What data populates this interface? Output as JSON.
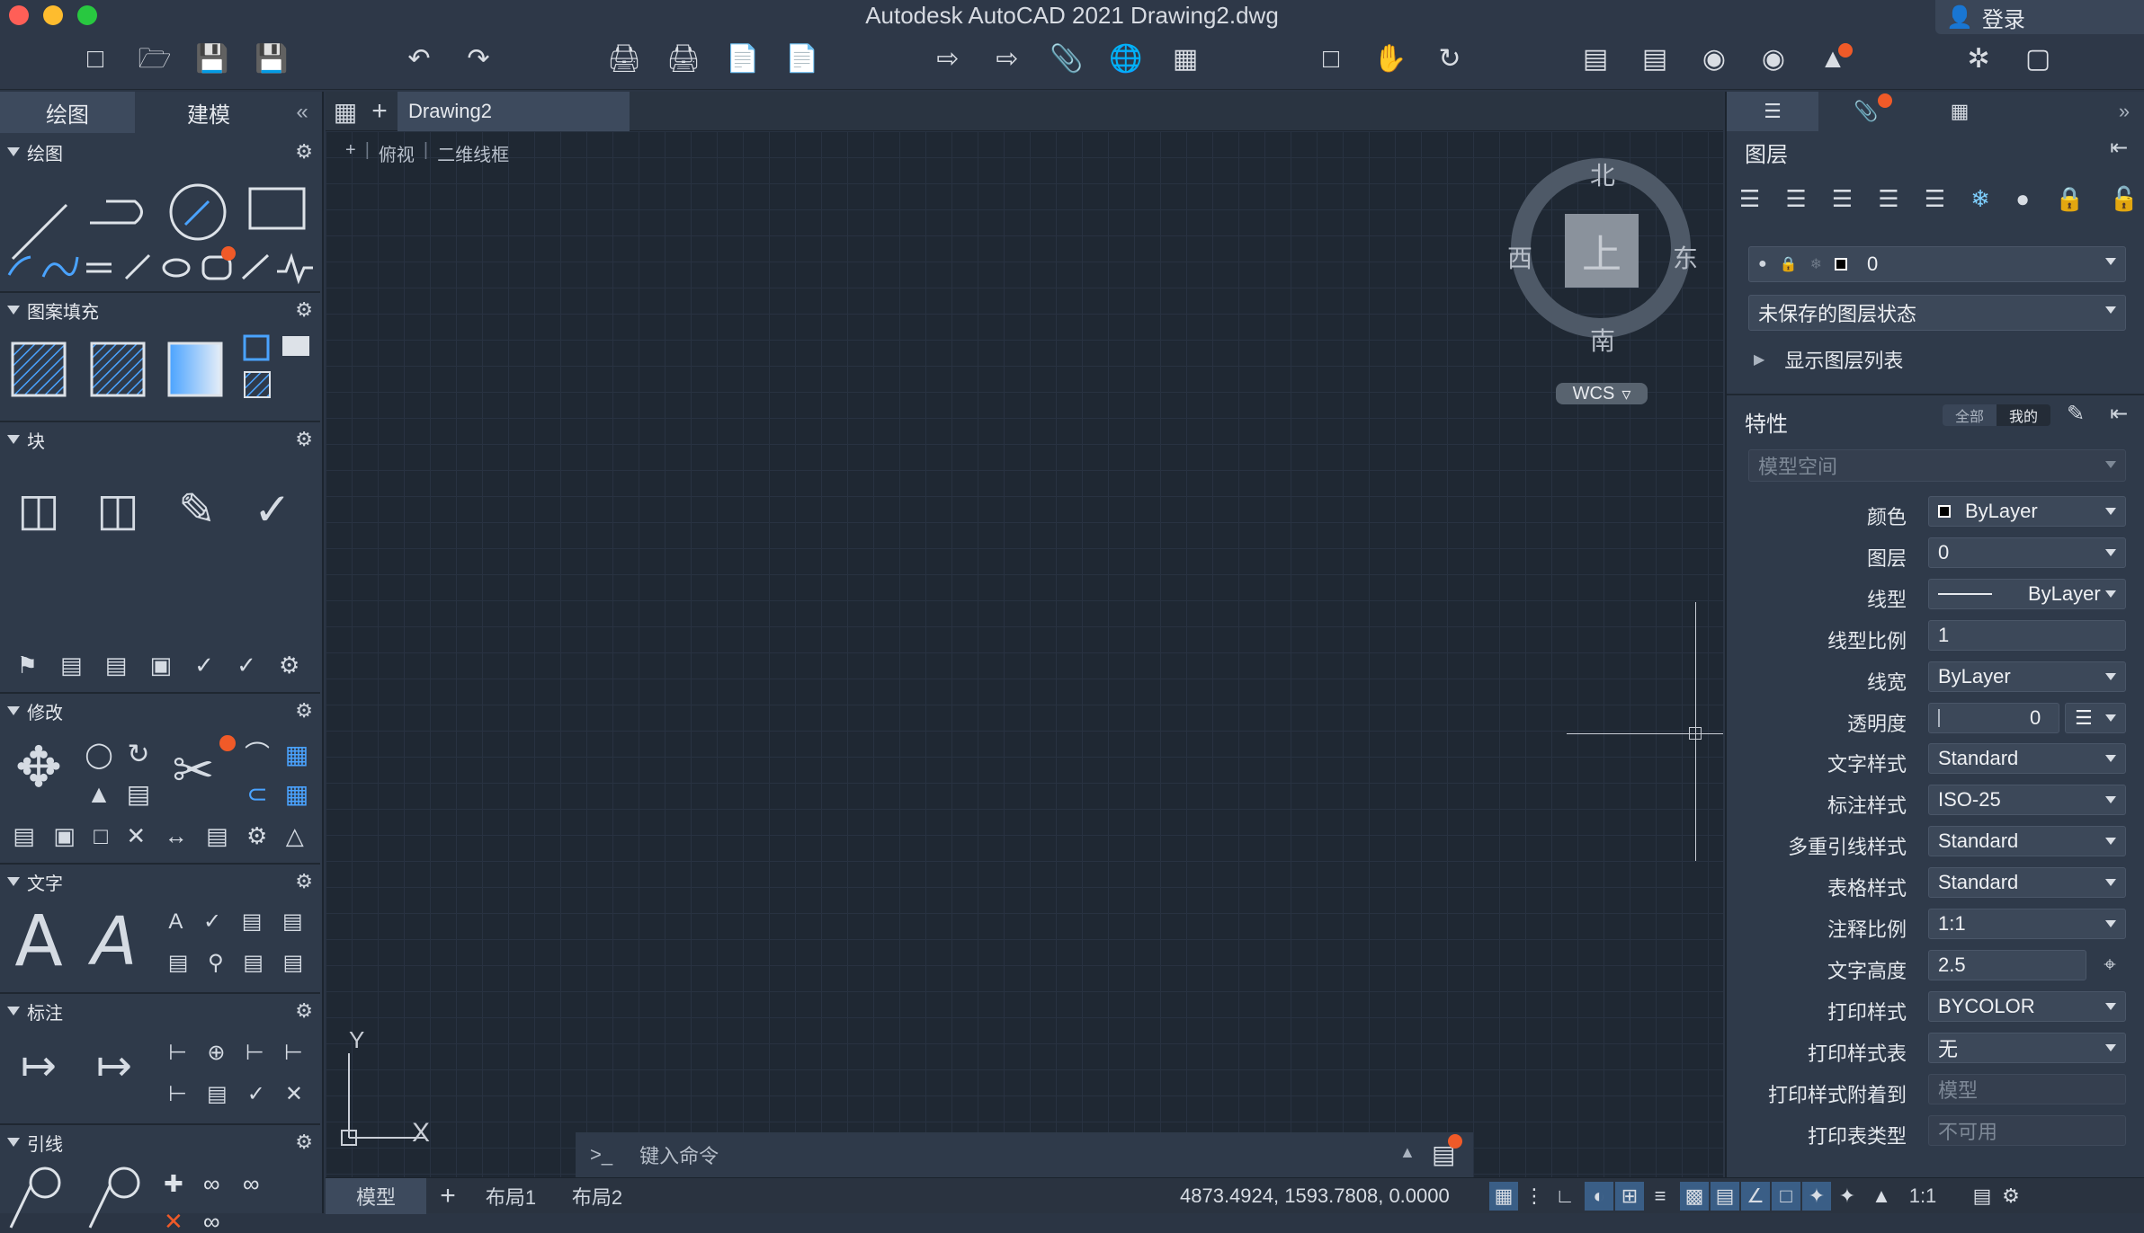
{
  "window": {
    "title": "Autodesk AutoCAD 2021    Drawing2.dwg",
    "login_label": "登录"
  },
  "left_panel": {
    "tabs": [
      "绘图",
      "建模"
    ],
    "sections": {
      "draw": "绘图",
      "hatch": "图案填充",
      "block": "块",
      "modify": "修改",
      "text": "文字",
      "dimension": "标注",
      "leader": "引线"
    }
  },
  "document": {
    "tab_name": "Drawing2",
    "view_label": "俯视",
    "visual_style": "二维线框"
  },
  "viewcube": {
    "north": "北",
    "south": "南",
    "east": "东",
    "west": "西",
    "face": "上",
    "wcs": "WCS"
  },
  "ucs": {
    "x": "X",
    "y": "Y"
  },
  "command": {
    "prompt": ">_",
    "placeholder": "键入命令"
  },
  "status": {
    "tabs": [
      "模型",
      "布局1",
      "布局2"
    ],
    "coords": "4873.4924, 1593.7808, 0.0000",
    "scale": "1:1"
  },
  "layers": {
    "title": "图层",
    "current_layer": "0",
    "layer_state": "未保存的图层状态",
    "show_list": "显示图层列表"
  },
  "properties": {
    "title": "特性",
    "filter_all": "全部",
    "filter_mine": "我的",
    "space": "模型空间",
    "rows": [
      {
        "label": "颜色",
        "value": "ByLayer"
      },
      {
        "label": "图层",
        "value": "0"
      },
      {
        "label": "线型",
        "value": "ByLayer"
      },
      {
        "label": "线型比例",
        "value": "1"
      },
      {
        "label": "线宽",
        "value": "ByLayer"
      },
      {
        "label": "透明度",
        "value": "0"
      },
      {
        "label": "文字样式",
        "value": "Standard"
      },
      {
        "label": "标注样式",
        "value": "ISO-25"
      },
      {
        "label": "多重引线样式",
        "value": "Standard"
      },
      {
        "label": "表格样式",
        "value": "Standard"
      },
      {
        "label": "注释比例",
        "value": "1:1"
      },
      {
        "label": "文字高度",
        "value": "2.5"
      },
      {
        "label": "打印样式",
        "value": "BYCOLOR"
      },
      {
        "label": "打印样式表",
        "value": "无"
      },
      {
        "label": "打印样式附着到",
        "value": "模型"
      },
      {
        "label": "打印表类型",
        "value": "不可用"
      }
    ]
  },
  "colors": {
    "accent": "#f05a28",
    "canvas": "#1f2833",
    "panel": "#2f3a4a"
  }
}
